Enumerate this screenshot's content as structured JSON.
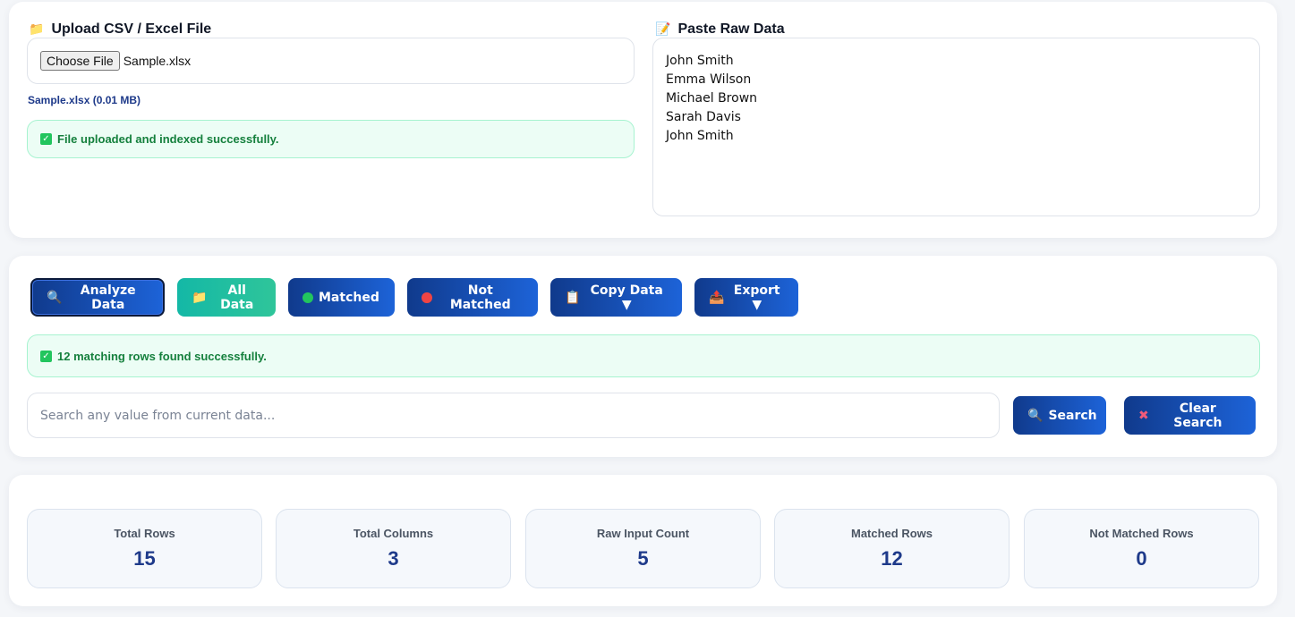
{
  "upload": {
    "title_icon": "folder-icon",
    "title": "Upload CSV / Excel File",
    "choose_label": "Choose File",
    "file_name": "Sample.xlsx",
    "file_meta": "Sample.xlsx (0.01 MB)",
    "status": "File uploaded and indexed successfully."
  },
  "raw": {
    "title_icon": "memo-icon",
    "title": "Paste Raw Data",
    "lines": [
      "John Smith",
      "Emma Wilson",
      "Michael Brown",
      "Sarah Davis",
      "John Smith"
    ]
  },
  "actions": {
    "analyze": "Analyze Data",
    "all_data": "All Data",
    "matched": "Matched",
    "not_matched": "Not Matched",
    "copy": "Copy Data ▼",
    "export": "Export ▼",
    "status": "12 matching rows found successfully.",
    "search_placeholder": "Search any value from current data...",
    "search": "Search",
    "clear_search": "Clear Search"
  },
  "stats": [
    {
      "label": "Total Rows",
      "value": "15"
    },
    {
      "label": "Total Columns",
      "value": "3"
    },
    {
      "label": "Raw Input Count",
      "value": "5"
    },
    {
      "label": "Matched Rows",
      "value": "12"
    },
    {
      "label": "Not Matched Rows",
      "value": "0"
    }
  ],
  "colors": {
    "primary_gradient_start": "#103a8c",
    "primary_gradient_end": "#1d63d8",
    "teal": "#14b8a6",
    "success_text": "#15803d",
    "success_bg": "#ecfdf5",
    "stat_value": "#1e3a8a"
  }
}
